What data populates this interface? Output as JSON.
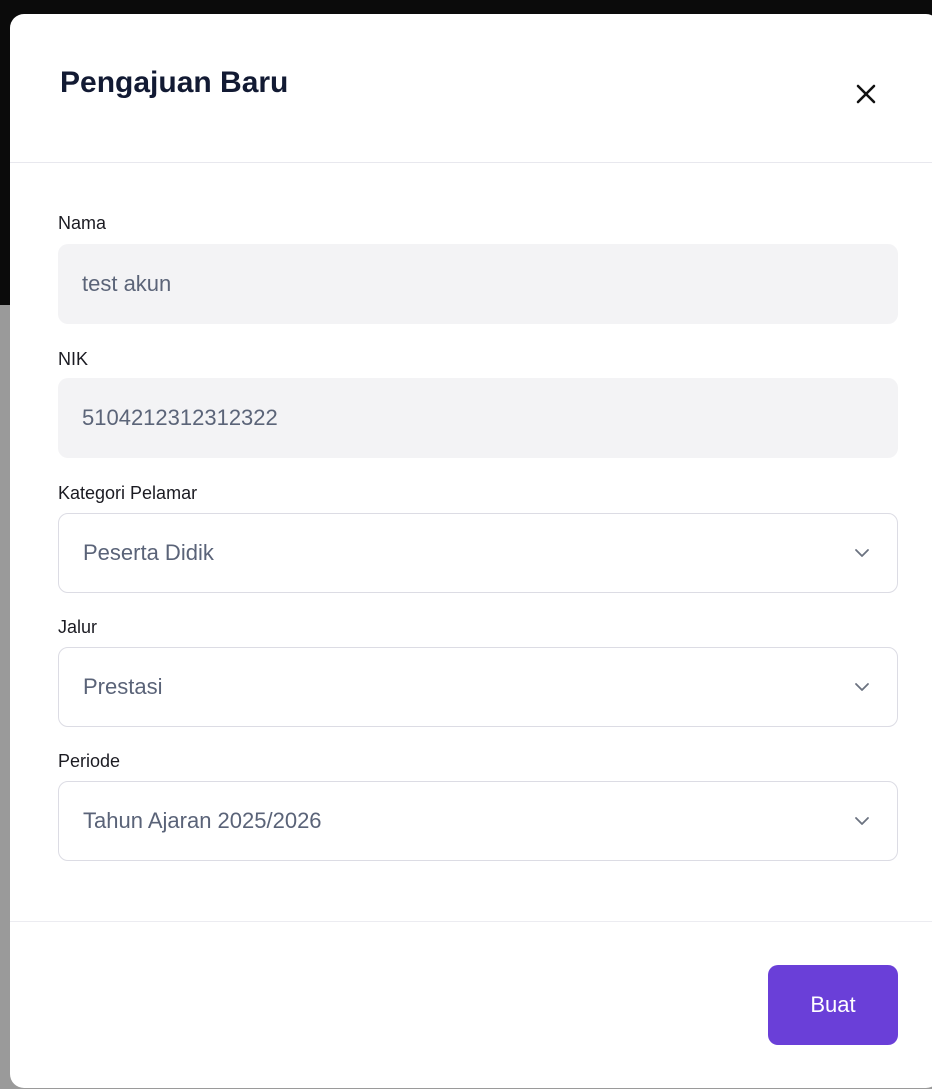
{
  "modal": {
    "title": "Pengajuan Baru"
  },
  "form": {
    "nama": {
      "label": "Nama",
      "value": "test akun"
    },
    "nik": {
      "label": "NIK",
      "value": "5104212312312322"
    },
    "kategori": {
      "label": "Kategori Pelamar",
      "value": "Peserta Didik"
    },
    "jalur": {
      "label": "Jalur",
      "value": "Prestasi"
    },
    "periode": {
      "label": "Periode",
      "value": "Tahun Ajaran 2025/2026"
    }
  },
  "footer": {
    "submit_label": "Buat"
  },
  "icons": {
    "close": "close-icon",
    "dropdown": "chevron-down-icon"
  },
  "colors": {
    "accent": "#6a3fd8",
    "title": "#121a33",
    "readonly_bg": "#f3f3f5"
  }
}
